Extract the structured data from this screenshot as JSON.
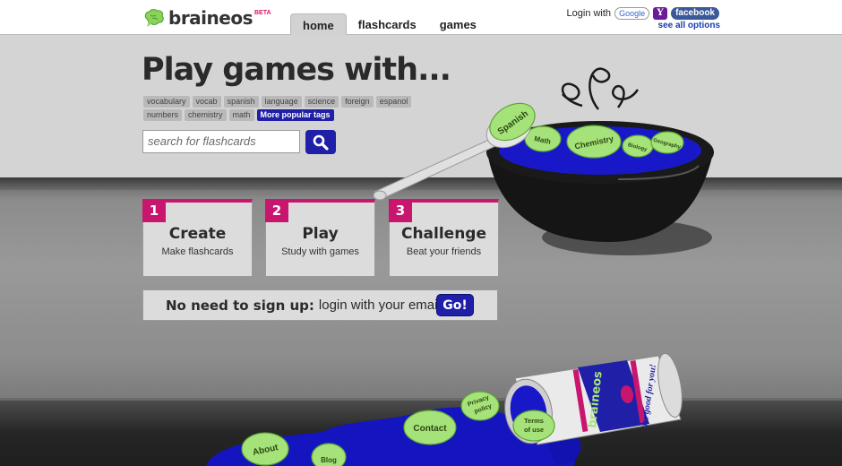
{
  "header": {
    "logo_text": "braineos",
    "logo_badge": "BETA",
    "tabs": [
      {
        "label": "home",
        "active": true
      },
      {
        "label": "flashcards",
        "active": false
      },
      {
        "label": "games",
        "active": false
      }
    ],
    "login_label": "Login with",
    "login_providers": [
      "Google",
      "Y",
      "facebook"
    ],
    "see_all_options": "see all options"
  },
  "hero": {
    "title": "Play games with...",
    "tags": [
      "vocabulary",
      "vocab",
      "spanish",
      "language",
      "science",
      "foreign",
      "espanol",
      "numbers",
      "chemistry",
      "math"
    ],
    "more_tags_label": "More popular tags",
    "search_placeholder": "search for flashcards"
  },
  "steps": [
    {
      "number": "1",
      "title": "Create",
      "subtitle": "Make flashcards"
    },
    {
      "number": "2",
      "title": "Play",
      "subtitle": "Study with games"
    },
    {
      "number": "3",
      "title": "Challenge",
      "subtitle": "Beat your friends"
    }
  ],
  "signup": {
    "bold_text": "No need to sign up:",
    "text": "login with your email!",
    "button_label": "Go!"
  },
  "illustration": {
    "bowl_brains": [
      "Spanish",
      "Math",
      "Chemistry",
      "Biology",
      "Geography"
    ],
    "floor_brains": [
      "About",
      "Privacy policy",
      "Contact",
      "Terms of use",
      "Blog"
    ],
    "can_label": "braineos",
    "can_slogan": "are good for you!"
  },
  "colors": {
    "accent_pink": "#c8166e",
    "button_blue": "#1f1fa8",
    "brain_green": "#a6e27a",
    "soup_blue": "#1818c8"
  }
}
